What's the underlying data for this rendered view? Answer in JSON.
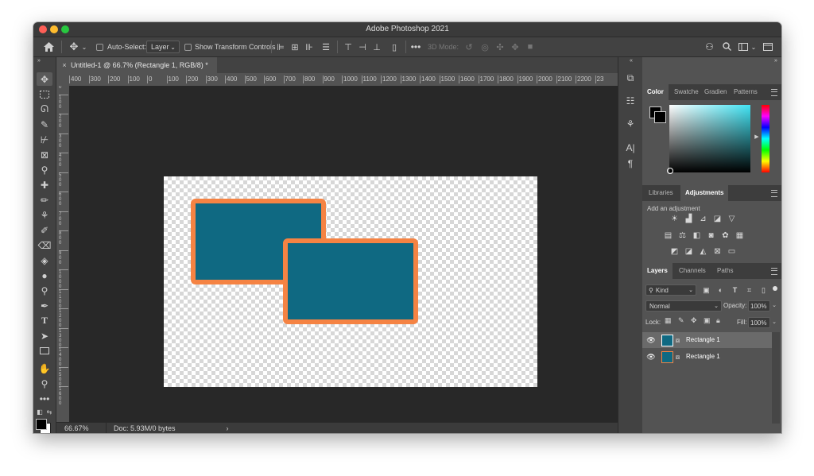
{
  "window": {
    "title": "Adobe Photoshop 2021"
  },
  "options_bar": {
    "auto_select_label": "Auto-Select:",
    "auto_select_target": "Layer",
    "show_transform_label": "Show Transform Controls",
    "mode_3d_label": "3D Mode:"
  },
  "document": {
    "tab_title": "Untitled-1 @ 66.7% (Rectangle 1, RGB/8) *",
    "zoom": "66.67%",
    "doc_info": "Doc: 5.93M/0 bytes",
    "ruler_top": [
      "400",
      "300",
      "200",
      "100",
      "0",
      "100",
      "200",
      "300",
      "400",
      "500",
      "600",
      "700",
      "800",
      "900",
      "1000",
      "1100",
      "1200",
      "1300",
      "1400",
      "1500",
      "1600",
      "1700",
      "1800",
      "1900",
      "2000",
      "2100",
      "2200",
      "23"
    ],
    "ruler_left": [
      "1\n0\n0",
      "1\n0\n0",
      "2\n0\n0",
      "3\n0\n0",
      "4\n0\n0",
      "5\n0\n0",
      "6\n0\n0",
      "7\n0\n0",
      "8\n0\n0",
      "9\n0\n0",
      "1\n0\n0\n0",
      "1\n1\n0\n0",
      "1\n2\n0\n0",
      "1\n3\n0\n0",
      "1\n4\n0\n0",
      "1\n5\n0\n0",
      "1\n6\n0\n0"
    ]
  },
  "color_panel": {
    "tabs": [
      "Color",
      "Swatche",
      "Gradien",
      "Patterns"
    ],
    "active": "Color"
  },
  "adjustments_panel": {
    "tabs": [
      "Libraries",
      "Adjustments"
    ],
    "active": "Adjustments",
    "hint": "Add an adjustment"
  },
  "layers_panel": {
    "tabs": [
      "Layers",
      "Channels",
      "Paths"
    ],
    "active": "Layers",
    "filter_label": "Kind",
    "blend_mode": "Normal",
    "opacity_label": "Opacity:",
    "opacity_value": "100%",
    "lock_label": "Lock:",
    "fill_label": "Fill:",
    "fill_value": "100%",
    "layers": [
      {
        "name": "Rectangle 1",
        "selected": true
      },
      {
        "name": "Rectangle 1",
        "selected": false
      }
    ]
  },
  "colors": {
    "accent_fill": "#0f6982",
    "accent_stroke": "#f58343"
  }
}
